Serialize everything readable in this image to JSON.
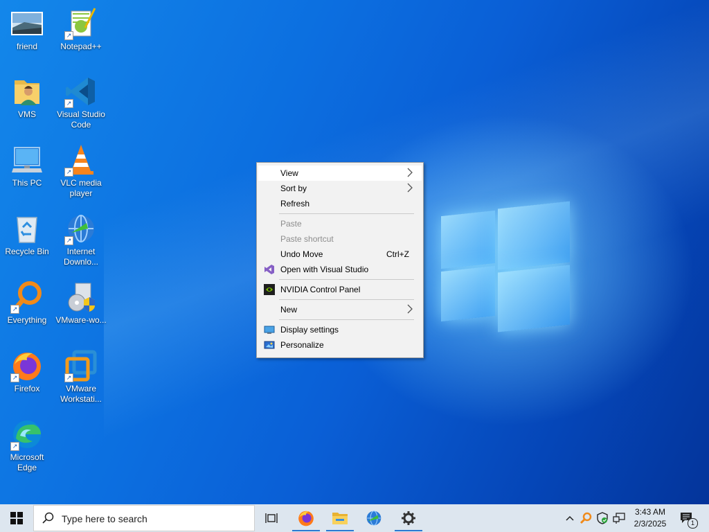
{
  "desktop_icons": [
    {
      "label": "friend",
      "icon": "photo-icon"
    },
    {
      "label": "Notepad++",
      "icon": "notepadpp-icon"
    },
    {
      "label": "VMS",
      "icon": "user-folder-icon"
    },
    {
      "label": "Visual Studio Code",
      "icon": "vscode-icon"
    },
    {
      "label": "This PC",
      "icon": "computer-icon"
    },
    {
      "label": "VLC media player",
      "icon": "vlc-icon"
    },
    {
      "label": "Recycle Bin",
      "icon": "recycle-bin-icon"
    },
    {
      "label": "Internet Downlo...",
      "icon": "idm-icon"
    },
    {
      "label": "Everything",
      "icon": "search-magnifier-icon"
    },
    {
      "label": "VMware-wo...",
      "icon": "installer-icon"
    },
    {
      "label": "Firefox",
      "icon": "firefox-icon"
    },
    {
      "label": "VMware Workstati...",
      "icon": "vmware-icon"
    },
    {
      "label": "Microsoft Edge",
      "icon": "edge-icon"
    }
  ],
  "context_menu": {
    "items": [
      {
        "label": "View",
        "submenu": true
      },
      {
        "label": "Sort by",
        "submenu": true
      },
      {
        "label": "Refresh"
      },
      {
        "label": "Paste",
        "disabled": true
      },
      {
        "label": "Paste shortcut",
        "disabled": true
      },
      {
        "label": "Undo Move",
        "shortcut": "Ctrl+Z"
      },
      {
        "label": "Open with Visual Studio",
        "icon": "visual-studio-icon"
      },
      {
        "label": "NVIDIA Control Panel",
        "icon": "nvidia-icon"
      },
      {
        "label": "New",
        "submenu": true
      },
      {
        "label": "Display settings",
        "icon": "display-icon"
      },
      {
        "label": "Personalize",
        "icon": "personalize-icon"
      }
    ]
  },
  "taskbar": {
    "search_placeholder": "Type here to search",
    "pinned": [
      "firefox-icon",
      "file-explorer-icon",
      "idm-icon",
      "settings-gear-icon"
    ],
    "time": "3:43 AM",
    "date": "2/3/2025",
    "notification_count": "1"
  },
  "colors": {
    "accent": "#0a5fd6",
    "taskbar_bg": "#dde6ef",
    "menu_bg": "#f2f2f2"
  }
}
